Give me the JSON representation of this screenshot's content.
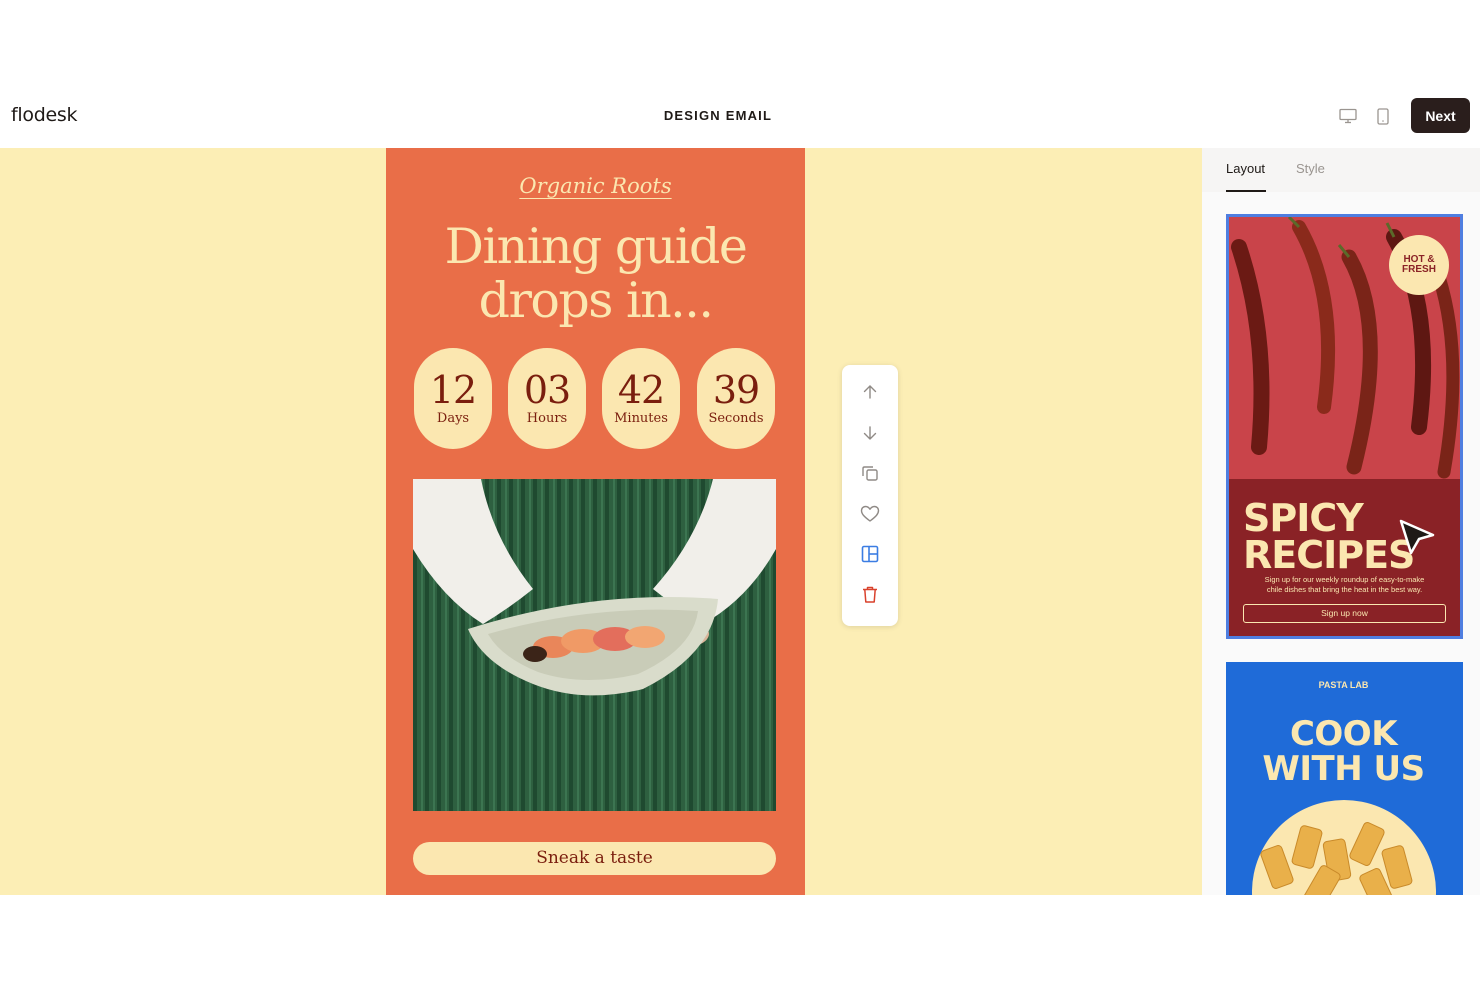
{
  "header": {
    "logo": "flodesk",
    "title": "DESIGN EMAIL",
    "desktop_icon": "desktop-monitor-icon",
    "mobile_icon": "mobile-phone-icon",
    "next_label": "Next"
  },
  "email": {
    "brand": "Organic Roots",
    "headline_line1": "Dining guide",
    "headline_line2": "drops in...",
    "countdown": [
      {
        "value": "12",
        "label": "Days"
      },
      {
        "value": "03",
        "label": "Hours"
      },
      {
        "value": "42",
        "label": "Minutes"
      },
      {
        "value": "39",
        "label": "Seconds"
      }
    ],
    "cta": "Sneak a taste",
    "colors": {
      "background": "#e96e48",
      "cream": "#fbe7b0",
      "text_dark": "#7a1e0e",
      "canvas": "#fceeb5"
    }
  },
  "toolbar": {
    "icons": [
      "arrow-up-icon",
      "arrow-down-icon",
      "duplicate-icon",
      "heart-icon",
      "layout-icon",
      "trash-icon"
    ]
  },
  "panel": {
    "tabs": [
      "Layout",
      "Style"
    ],
    "active_tab": "Layout",
    "templates": [
      {
        "badge_line1": "HOT &",
        "badge_line2": "FRESH",
        "title_line1": "SPICY",
        "title_line2": "RECIPES",
        "body_line1": "Sign up for our weekly roundup of easy-to-make",
        "body_line2": "chile dishes that bring the heat in the best way.",
        "button": "Sign up now",
        "selected": true
      },
      {
        "kicker": "PASTA LAB",
        "title_line1": "COOK",
        "title_line2": "WITH US",
        "selected": false
      }
    ]
  }
}
